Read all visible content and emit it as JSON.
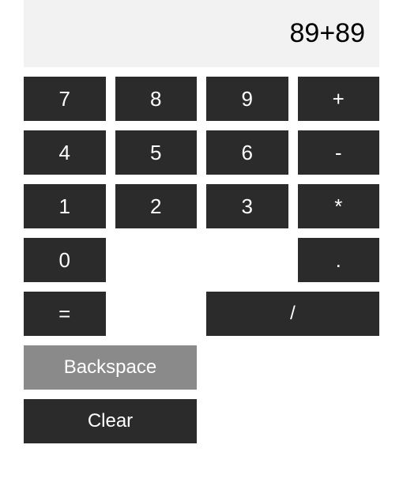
{
  "display": {
    "expression": "89+89"
  },
  "keys": {
    "seven": "7",
    "eight": "8",
    "nine": "9",
    "plus": "+",
    "four": "4",
    "five": "5",
    "six": "6",
    "minus": "-",
    "one": "1",
    "two": "2",
    "three": "3",
    "multiply": "*",
    "zero": "0",
    "decimal": ".",
    "equals": "=",
    "divide": "/",
    "backspace": "Backspace",
    "clear": "Clear"
  },
  "colors": {
    "display_bg": "#f2f2f2",
    "button_bg": "#2b2b2b",
    "button_gray_bg": "#8a8a8a",
    "button_fg": "#ffffff"
  }
}
